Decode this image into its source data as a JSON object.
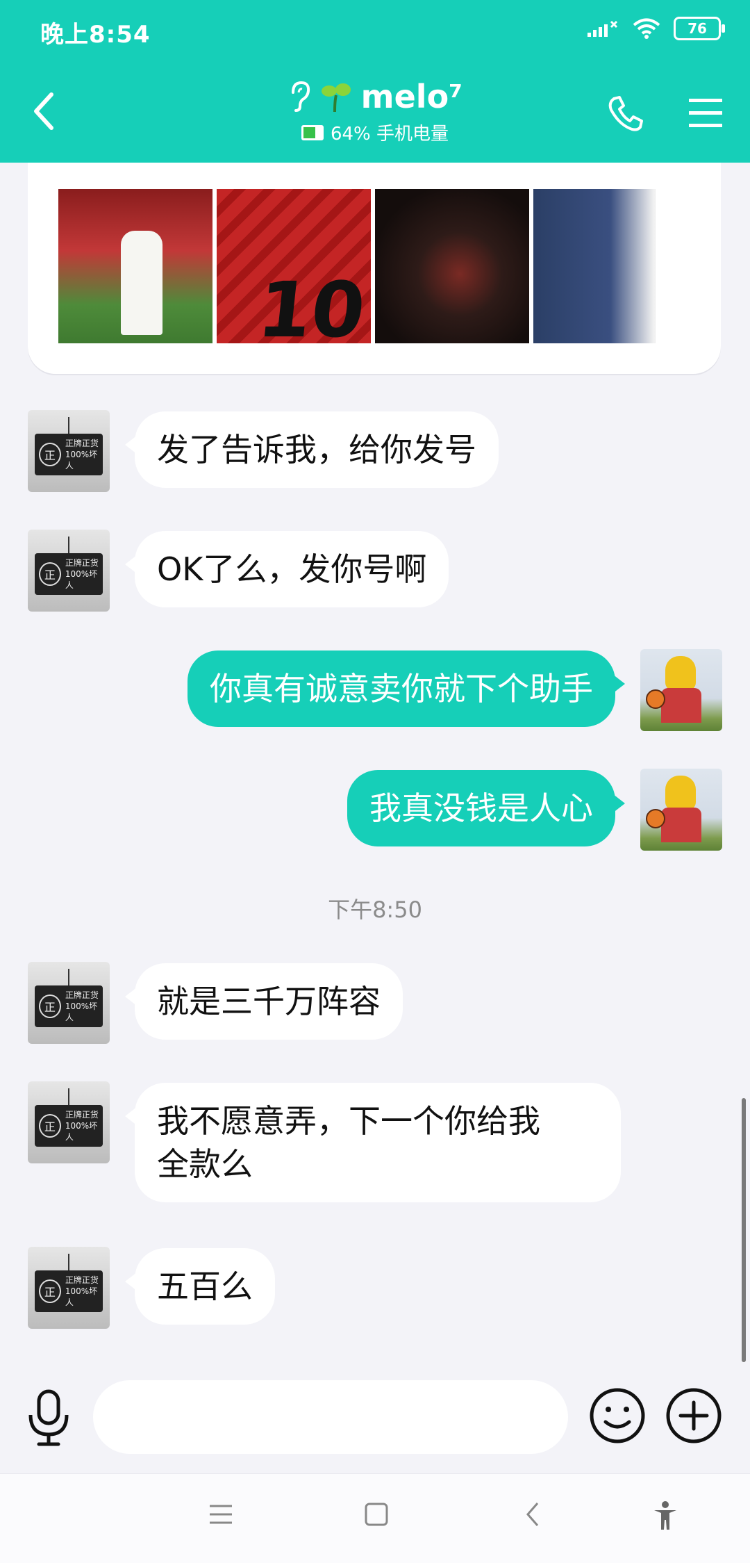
{
  "status": {
    "time": "晚上8:54",
    "battery": "76"
  },
  "header": {
    "title": "melo⁷",
    "battery_status": "64% 手机电量"
  },
  "messages": [
    {
      "from": "other",
      "text": "发了告诉我，给你发号"
    },
    {
      "from": "other",
      "text": "OK了么，发你号啊"
    },
    {
      "from": "me",
      "text": "你真有诚意卖你就下个助手"
    },
    {
      "from": "me",
      "text": "我真没钱是人心"
    },
    {
      "from": "other",
      "text": "就是三千万阵容"
    },
    {
      "from": "other",
      "text": "我不愿意弄，下一个你给我\n全款么"
    },
    {
      "from": "other",
      "text": "五百么"
    }
  ],
  "timestamp": "下午8:50",
  "avatar_sign": {
    "glyph": "正",
    "line1": "正牌正货",
    "line2": "100%坏人"
  },
  "photo_jersey_number": "10",
  "icons": [
    "back-arrow-icon",
    "ear-icon",
    "sprout-icon",
    "phone-icon",
    "menu-icon",
    "microphone-icon",
    "emoji-icon",
    "plus-icon",
    "nav-menu-icon",
    "nav-home-icon",
    "nav-back-icon",
    "accessibility-icon",
    "signal-icon",
    "wifi-icon",
    "battery-icon"
  ],
  "colors": {
    "accent": "#16cfb8",
    "background": "#f3f3f8",
    "incoming_bubble": "#ffffff"
  }
}
